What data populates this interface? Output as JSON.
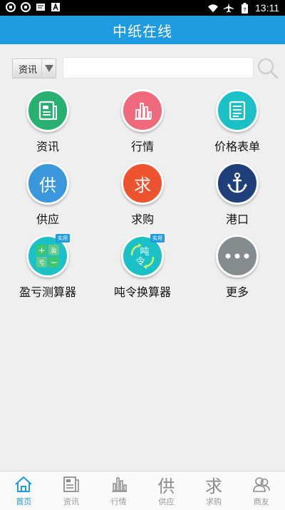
{
  "statusbar": {
    "time": "13:11"
  },
  "app": {
    "title": "中纸在线"
  },
  "search": {
    "category_label": "资讯",
    "value": ""
  },
  "grid": [
    {
      "label": "资讯",
      "icon": "news-doc-icon",
      "color": "#27b070",
      "glyph": ""
    },
    {
      "label": "行情",
      "icon": "bar-chart-icon",
      "color": "#ef6a7c",
      "glyph": ""
    },
    {
      "label": "价格表单",
      "icon": "list-doc-icon",
      "color": "#1cc1c7",
      "glyph": ""
    },
    {
      "label": "供应",
      "icon": "supply-char-icon",
      "color": "#3b97dc",
      "glyph": "供"
    },
    {
      "label": "求购",
      "icon": "purchase-char-icon",
      "color": "#ee5330",
      "glyph": "求"
    },
    {
      "label": "港口",
      "icon": "anchor-icon",
      "color": "#1e3f7a",
      "glyph": ""
    },
    {
      "label": "盈亏测算器",
      "icon": "calculator-icon",
      "color": "#1cc1c7",
      "glyph": "",
      "badge": "实用"
    },
    {
      "label": "吨令换算器",
      "icon": "converter-icon",
      "color": "#1cc1c7",
      "glyph": "",
      "badge": "实用"
    },
    {
      "label": "更多",
      "icon": "more-icon",
      "color": "#848c90",
      "glyph": ""
    }
  ],
  "calculator_keys": [
    "+",
    "盈",
    "亏",
    "−"
  ],
  "converter_keys": [
    "吨",
    "令"
  ],
  "tabs": [
    {
      "label": "首页",
      "icon": "home-icon",
      "glyph": ""
    },
    {
      "label": "资讯",
      "icon": "news-icon",
      "glyph": ""
    },
    {
      "label": "行情",
      "icon": "chart-icon",
      "glyph": ""
    },
    {
      "label": "供应",
      "icon": "supply-icon",
      "glyph": "供"
    },
    {
      "label": "求购",
      "icon": "purchase-icon",
      "glyph": "求"
    },
    {
      "label": "商友",
      "icon": "contacts-icon",
      "glyph": ""
    }
  ],
  "colors": {
    "brand": "#1e9be1",
    "active_tab": "#1e9be1",
    "inactive_tab": "#9a9a9a"
  }
}
